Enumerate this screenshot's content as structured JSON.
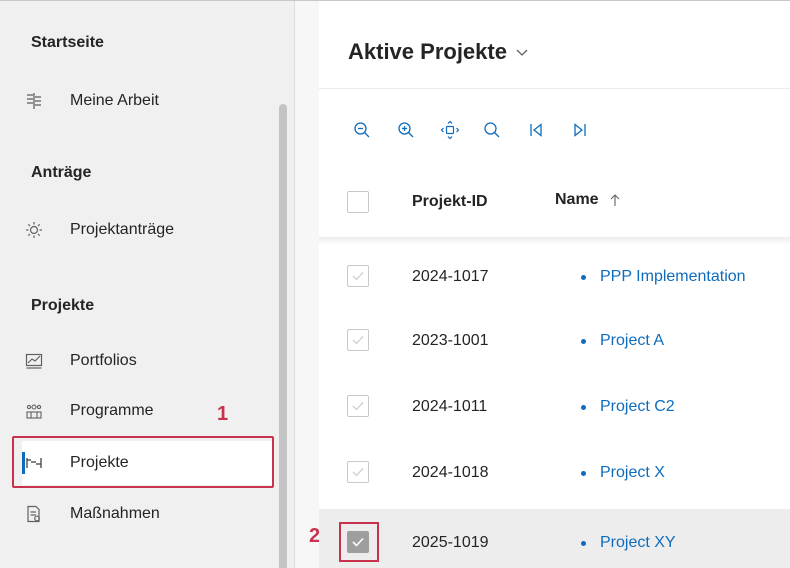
{
  "sidebar": {
    "sections": [
      {
        "title": "Startseite",
        "items": [
          {
            "label": "Meine Arbeit",
            "icon": "my-work-icon"
          }
        ]
      },
      {
        "title": "Anträge",
        "items": [
          {
            "label": "Projektanträge",
            "icon": "lightbulb-icon"
          }
        ]
      },
      {
        "title": "Projekte",
        "items": [
          {
            "label": "Portfolios",
            "icon": "portfolio-icon"
          },
          {
            "label": "Programme",
            "icon": "programs-icon"
          },
          {
            "label": "Projekte",
            "icon": "projects-icon",
            "selected": true
          },
          {
            "label": "Maßnahmen",
            "icon": "measures-icon"
          }
        ]
      }
    ]
  },
  "annotations": {
    "step1": "1",
    "step2": "2"
  },
  "main": {
    "title": "Aktive Projekte",
    "toolbar": [
      {
        "icon": "zoom-out-icon"
      },
      {
        "icon": "zoom-in-icon"
      },
      {
        "icon": "fit-view-icon"
      },
      {
        "icon": "search-icon"
      },
      {
        "icon": "first-page-icon"
      },
      {
        "icon": "last-page-icon"
      }
    ],
    "table": {
      "columns": [
        "Projekt-ID",
        "Name"
      ],
      "sort": {
        "column": "Name",
        "direction": "ascending"
      },
      "rows": [
        {
          "id": "2024-1017",
          "name": "PPP Implementation",
          "checked": false
        },
        {
          "id": "2023-1001",
          "name": "Project A",
          "checked": false
        },
        {
          "id": "2024-1011",
          "name": "Project C2",
          "checked": false
        },
        {
          "id": "2024-1018",
          "name": "Project X",
          "checked": false
        },
        {
          "id": "2025-1019",
          "name": "Project XY",
          "checked": true
        }
      ]
    }
  },
  "colors": {
    "accent": "#0f6cbd",
    "annotation": "#c8324c",
    "sidebar_bg": "#f0f0f0"
  }
}
